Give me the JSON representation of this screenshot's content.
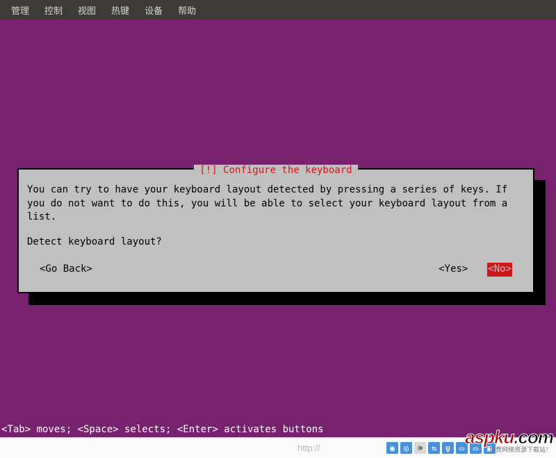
{
  "menubar": {
    "items": [
      "管理",
      "控制",
      "视图",
      "热键",
      "设备",
      "帮助"
    ]
  },
  "dialog": {
    "title": "[!] Configure the keyboard",
    "para1": "You can try to have your keyboard layout detected by pressing a series of keys. If you do not want to do this, you will be able to select your keyboard layout from a list.",
    "para2": "Detect keyboard layout?",
    "go_back": "<Go Back>",
    "yes": "<Yes>",
    "no": "<No>"
  },
  "footer_hint": "<Tab> moves; <Space> selects; <Enter> activates buttons",
  "taskbar": {
    "url": "http://"
  },
  "watermark": {
    "main_red": "aspku",
    "main_black": ".com",
    "sub": "免费网络资源下载站！"
  }
}
